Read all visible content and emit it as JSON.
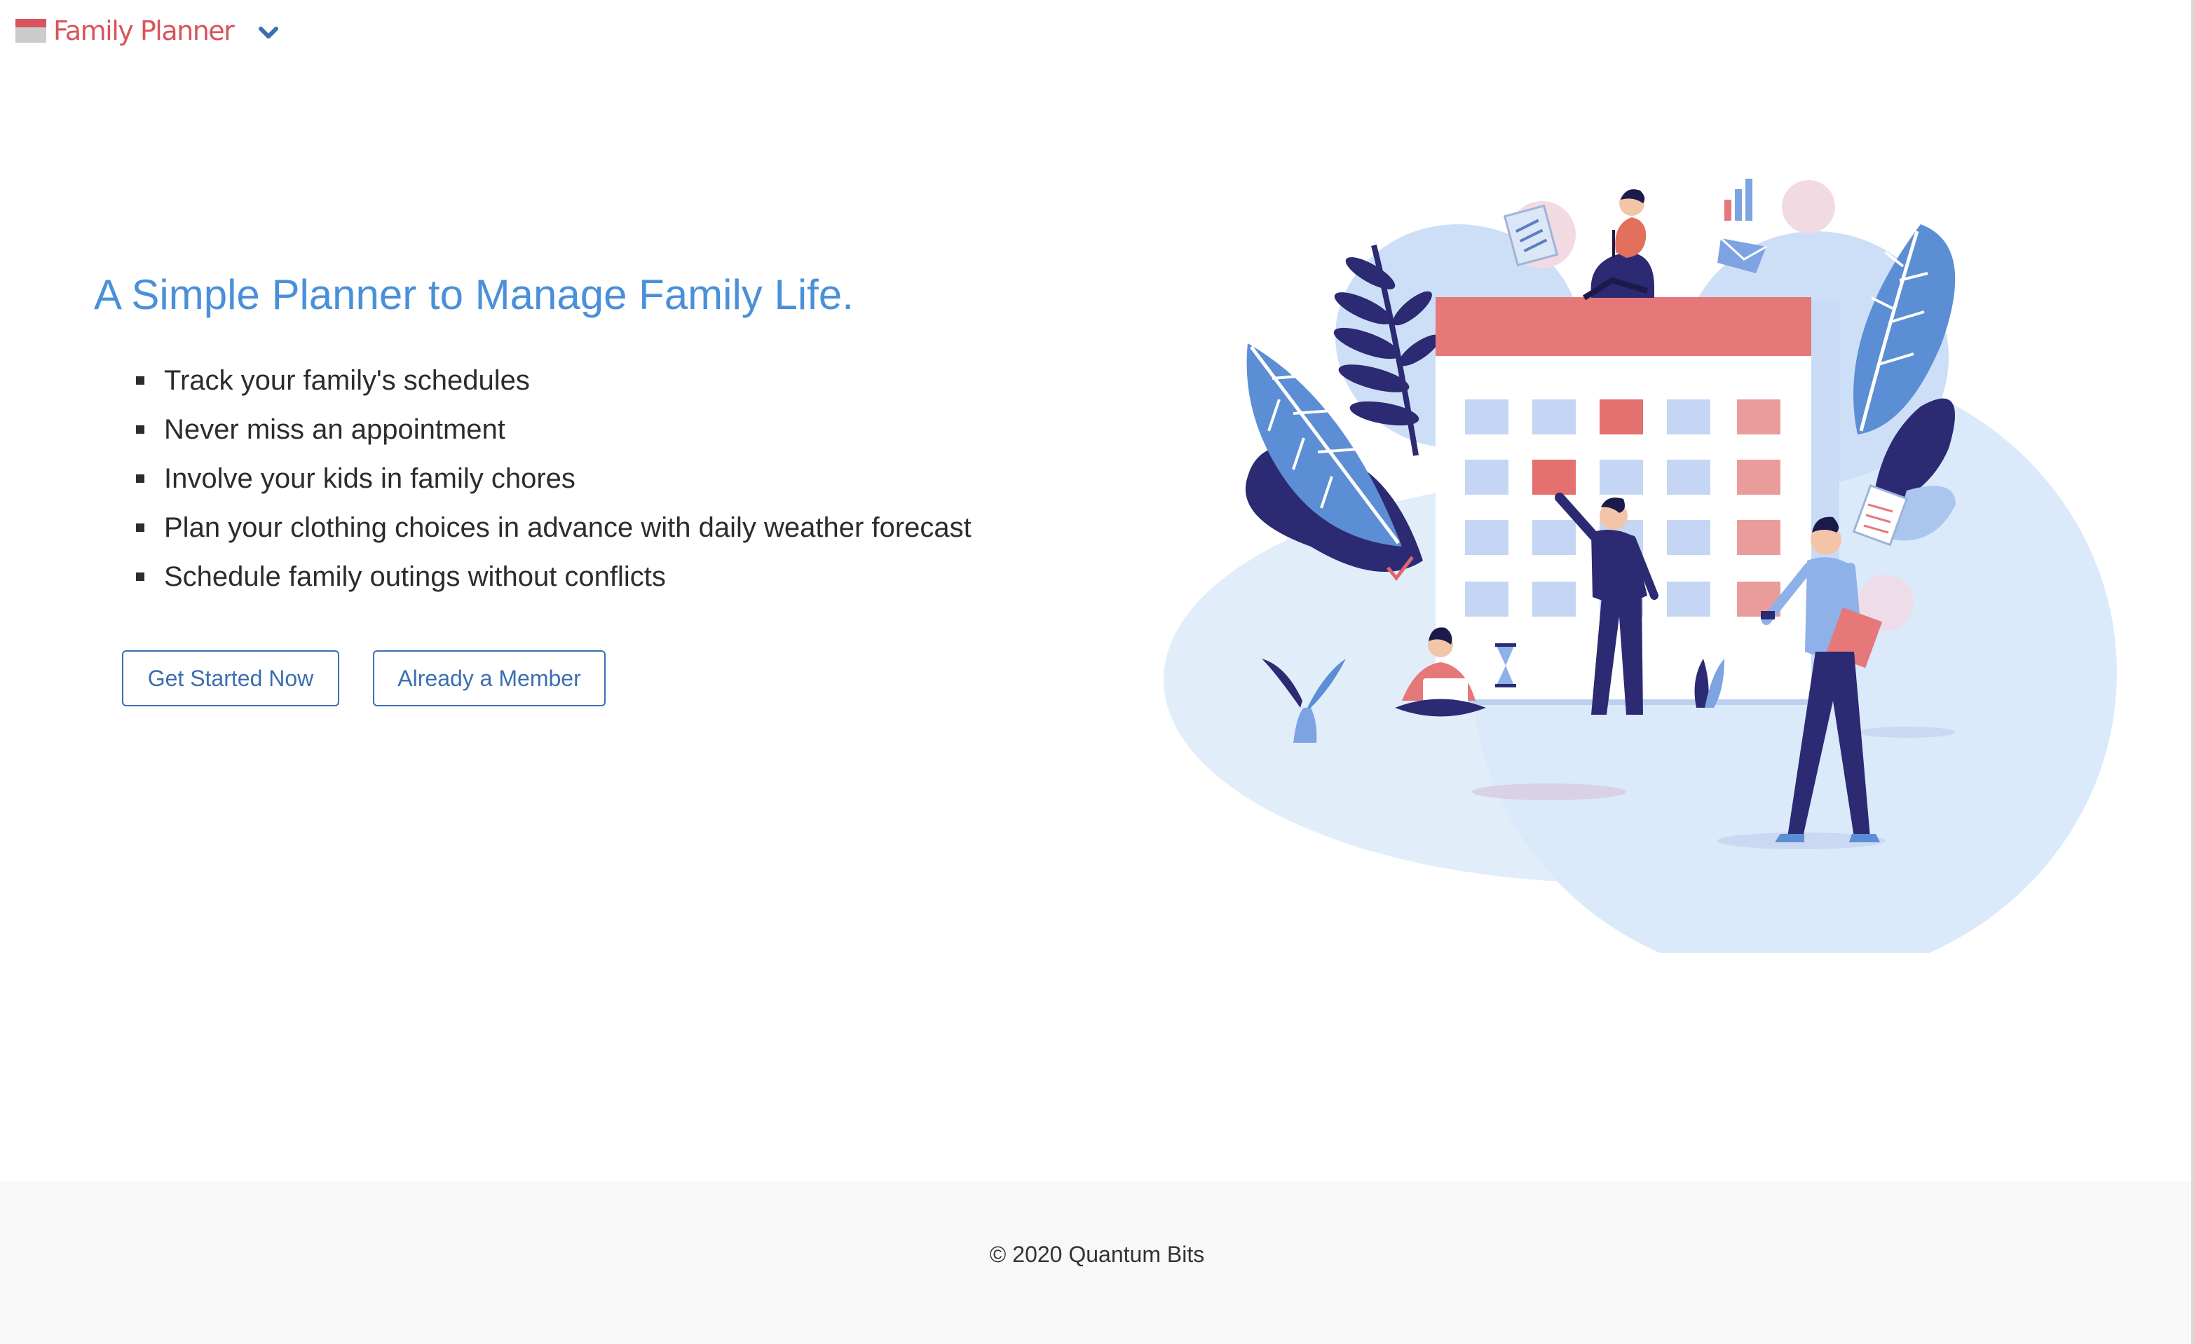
{
  "header": {
    "brand": "Family Planner",
    "brand_icon": "calendar-icon",
    "menu_icon": "chevron-down-icon"
  },
  "hero": {
    "title": "A Simple Planner to Manage Family Life.",
    "features": [
      "Track your family's schedules",
      "Never miss an appointment",
      "Involve your kids in family chores",
      "Plan your clothing choices in advance with daily weather forecast",
      "Schedule family outings without conflicts"
    ],
    "buttons": {
      "get_started": "Get Started Now",
      "member": "Already a Member"
    },
    "illustration": "family-calendar-illustration"
  },
  "footer": {
    "copyright": "© 2020 Quantum Bits"
  },
  "colors": {
    "brand": "#d9545c",
    "title": "#4a90d9",
    "button": "#3a6fb0",
    "footer_bg": "#f8f8f8"
  }
}
